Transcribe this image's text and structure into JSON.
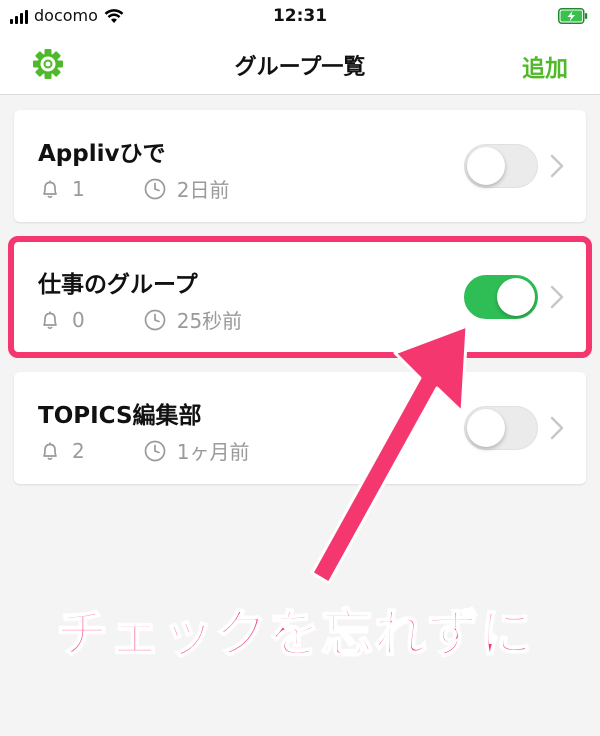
{
  "status_bar": {
    "carrier": "docomo",
    "time": "12:31"
  },
  "nav": {
    "title": "グループ一覧",
    "add_label": "追加",
    "left_icon": "gear-icon"
  },
  "colors": {
    "accent": "#4fb92a",
    "toggle_on": "#2fbe55",
    "annotation": "#f5376f"
  },
  "groups": [
    {
      "name": "Applivひで",
      "notifications": "1",
      "last_updated": "2日前",
      "enabled": false
    },
    {
      "name": "仕事のグループ",
      "notifications": "0",
      "last_updated": "25秒前",
      "enabled": true
    },
    {
      "name": "TOPICS編集部",
      "notifications": "2",
      "last_updated": "1ヶ月前",
      "enabled": false
    }
  ],
  "annotation": {
    "callout": "チェックを忘れずに"
  }
}
